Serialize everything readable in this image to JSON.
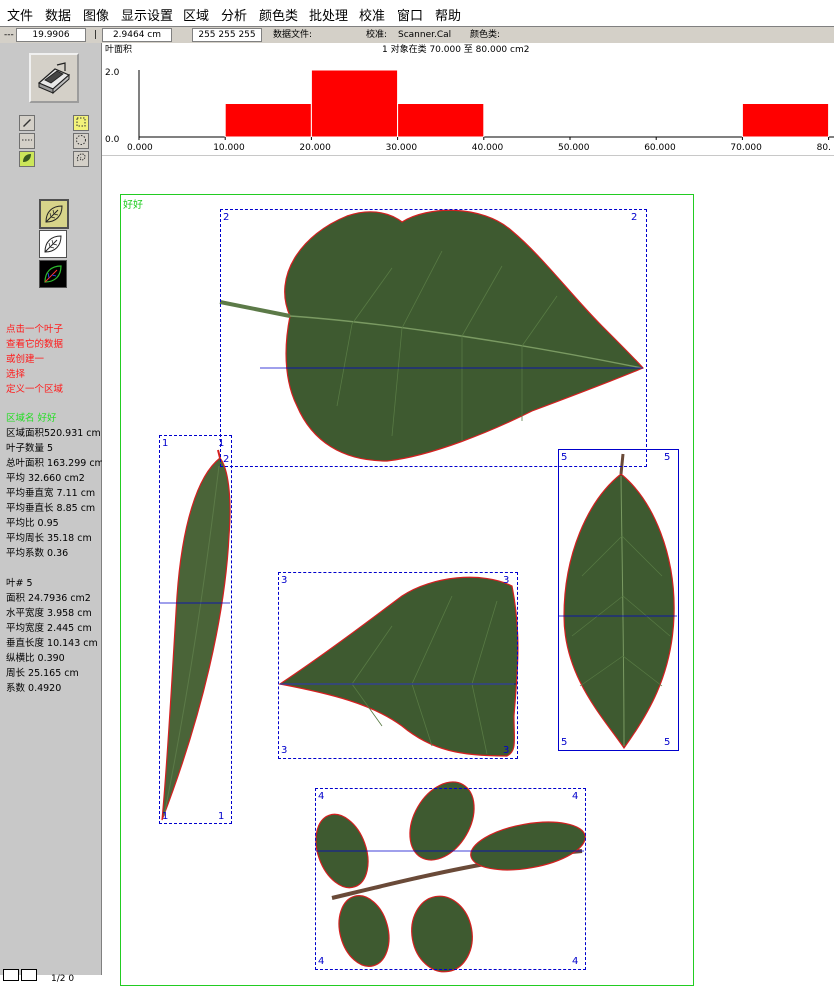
{
  "menu": [
    "文件",
    "数据",
    "图像",
    "显示设置",
    "区域",
    "分析",
    "颜色类",
    "批处理",
    "校准",
    "窗口",
    "帮助"
  ],
  "status": {
    "field_dash": "---",
    "field1": "19.9906",
    "sep": "|",
    "field2": "2.9464 cm",
    "field3": "255 255 255",
    "data_file_label": "数据文件:",
    "calib_label": "校准:",
    "calib_value": "Scanner.Cal",
    "color_class_label": "颜色类:"
  },
  "histogram": {
    "ylabel": "叶面积",
    "summary": "1 对象在类 70.000 至 80.000 cm2",
    "y_ticks": [
      "2.0",
      "0.0"
    ],
    "x_ticks": [
      "0.000",
      "10.000",
      "20.000",
      "30.000",
      "40.000",
      "50.000",
      "60.000",
      "70.000",
      "80."
    ],
    "bar_color": "#ff0000"
  },
  "chart_data": {
    "type": "bar",
    "ylabel": "叶面积",
    "title": "1 对象在类 70.000 至 80.000 cm2",
    "bins": [
      [
        10,
        20
      ],
      [
        20,
        30
      ],
      [
        30,
        40
      ],
      [
        70,
        80
      ]
    ],
    "values": [
      1,
      2,
      1,
      1
    ],
    "xlim": [
      0,
      80
    ],
    "ylim": [
      0,
      2
    ]
  },
  "help_text": [
    "点击一个叶子",
    "查看它的数据",
    "或创建一",
    "选择",
    "定义一个区域"
  ],
  "region_info": {
    "header": "区域名 好好",
    "lines": [
      "区域面积520.931 cm",
      "叶子数量 5",
      "总叶面积 163.299 cm",
      "平均 32.660 cm2",
      "平均垂直宽 7.11 cm",
      "平均垂直长 8.85 cm",
      "平均比 0.95",
      "平均周长 35.18 cm",
      "平均系数 0.36"
    ]
  },
  "leaf_info": {
    "lines": [
      "叶#  5",
      "面积 24.7936 cm2",
      "水平宽度 3.958 cm",
      "平均宽度 2.445 cm",
      "垂直长度 10.143 cm",
      "纵横比 0.390",
      "周长 25.165 cm",
      "系数 0.4920"
    ]
  },
  "pager_text": "1/2 0",
  "region": {
    "label": "好好",
    "color": "#22cc22"
  },
  "leaves": [
    {
      "id": "1",
      "kind": "narrow"
    },
    {
      "id": "2",
      "kind": "heart"
    },
    {
      "id": "3",
      "kind": "serrated"
    },
    {
      "id": "4",
      "kind": "compound"
    },
    {
      "id": "5",
      "kind": "ellipse"
    }
  ],
  "colors": {
    "leaf": "#3e5a30",
    "outline": "#d42020",
    "box": "#0000cc",
    "panel": "#c8c8c8"
  }
}
